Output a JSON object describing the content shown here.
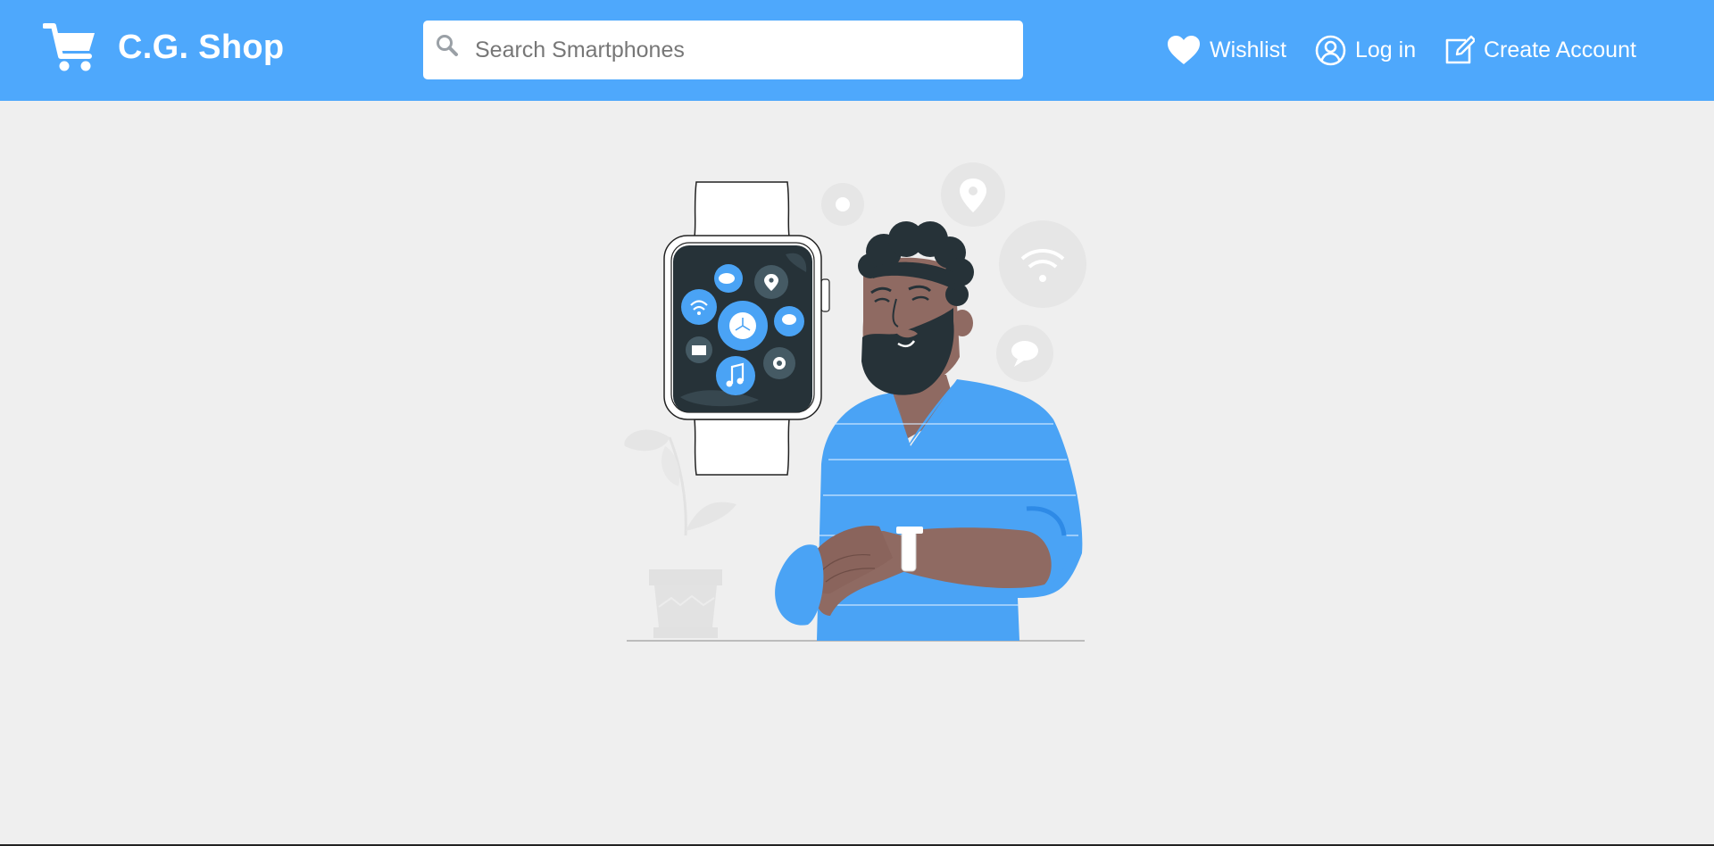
{
  "header": {
    "brand": {
      "name": "C.G. Shop",
      "icon": "cart-icon"
    },
    "search": {
      "placeholder": "Search Smartphones",
      "value": "",
      "icon": "search-icon"
    },
    "links": [
      {
        "label": "Wishlist",
        "icon": "heart-icon"
      },
      {
        "label": "Log in",
        "icon": "user-circle-icon"
      },
      {
        "label": "Create Account",
        "icon": "edit-icon"
      }
    ]
  },
  "hero": {
    "illustration": "man-checking-smartwatch"
  },
  "colors": {
    "navbar": "#4ea8fc",
    "background": "#efefef",
    "accent": "#4aa3f5",
    "skin": "#8f6a62",
    "hair": "#263238"
  }
}
